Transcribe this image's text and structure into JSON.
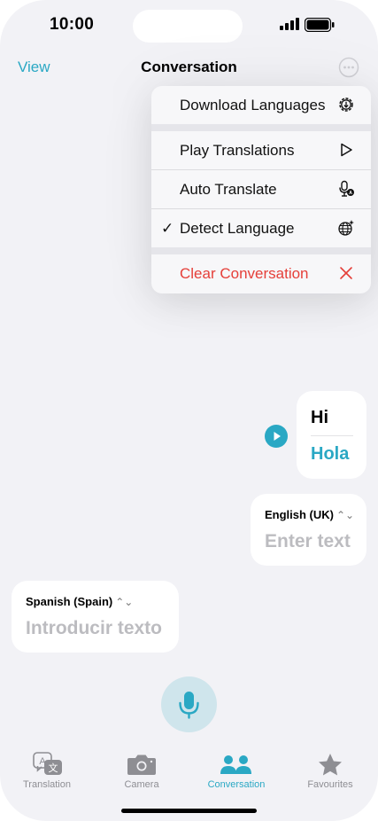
{
  "status_bar": {
    "time": "10:00"
  },
  "nav": {
    "left_label": "View",
    "title": "Conversation"
  },
  "menu": {
    "items": [
      {
        "label": "Download Languages",
        "icon": "gear-download-icon"
      },
      {
        "label": "Play Translations",
        "icon": "play-outline-icon"
      },
      {
        "label": "Auto Translate",
        "icon": "auto-mic-icon"
      },
      {
        "label": "Detect Language",
        "icon": "globe-sparkle-icon",
        "checked": true,
        "check_mark": "✓"
      },
      {
        "label": "Clear Conversation",
        "icon": "close-x-icon",
        "destructive": true
      }
    ]
  },
  "conversation": {
    "message": {
      "original": "Hi",
      "translation": "Hola"
    },
    "english_input": {
      "language": "English (UK)",
      "placeholder": "Enter text",
      "chevron": "⌃⌄"
    },
    "spanish_input": {
      "language": "Spanish (Spain)",
      "placeholder": "Introducir texto",
      "chevron": "⌃⌄"
    }
  },
  "tabbar": {
    "tabs": [
      {
        "label": "Translation",
        "icon": "translate-icon",
        "active": false
      },
      {
        "label": "Camera",
        "icon": "camera-icon",
        "active": false
      },
      {
        "label": "Conversation",
        "icon": "people-icon",
        "active": true
      },
      {
        "label": "Favourites",
        "icon": "star-icon",
        "active": false
      }
    ]
  },
  "colors": {
    "accent": "#2aa8c4",
    "destructive": "#e5403a",
    "background": "#f2f2f6"
  }
}
